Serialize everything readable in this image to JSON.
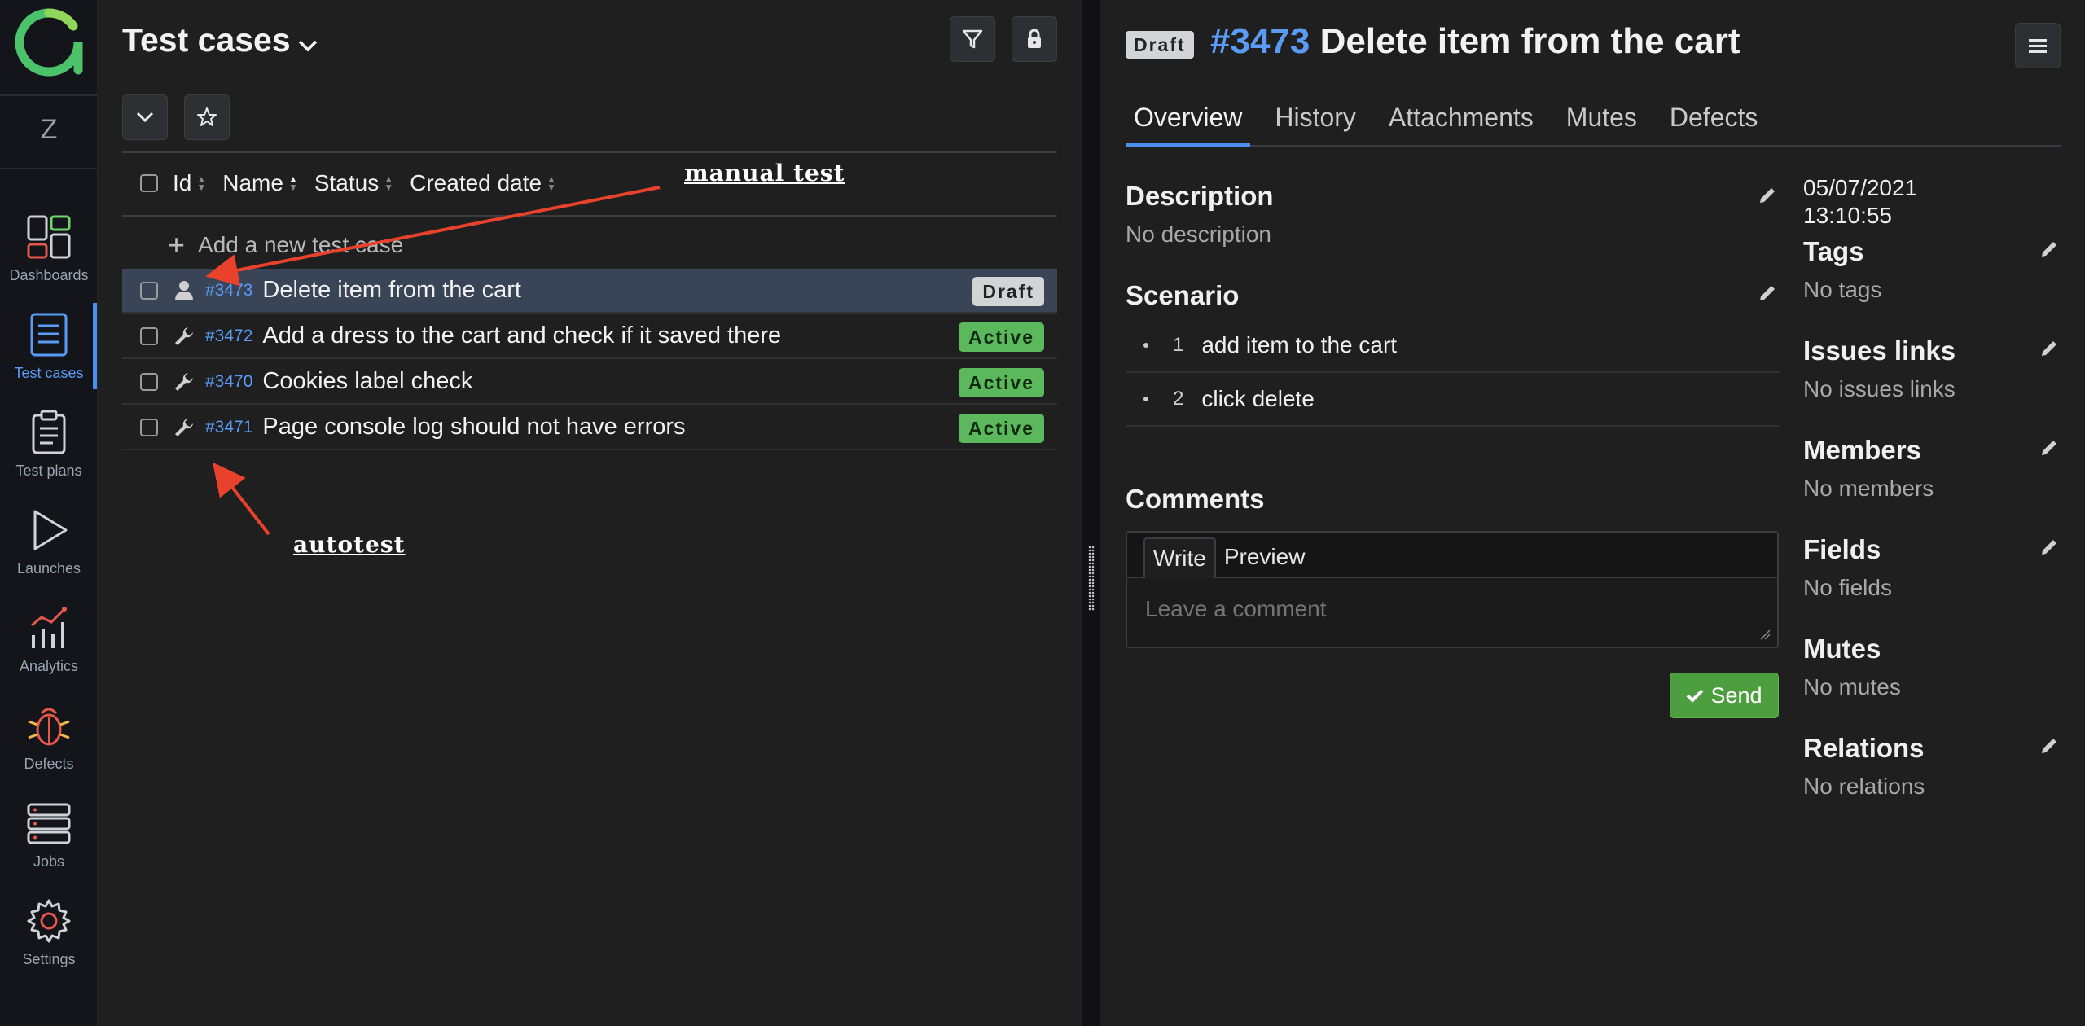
{
  "sidebar": {
    "project_initial": "Z",
    "items": [
      {
        "label": "Dashboards",
        "icon": "dashboards-icon"
      },
      {
        "label": "Test cases",
        "icon": "test-cases-icon",
        "active": true
      },
      {
        "label": "Test plans",
        "icon": "test-plans-icon"
      },
      {
        "label": "Launches",
        "icon": "launches-icon"
      },
      {
        "label": "Analytics",
        "icon": "analytics-icon"
      },
      {
        "label": "Defects",
        "icon": "defects-icon"
      },
      {
        "label": "Jobs",
        "icon": "jobs-icon"
      },
      {
        "label": "Settings",
        "icon": "settings-icon"
      }
    ]
  },
  "list": {
    "title": "Test cases",
    "columns": [
      "Id",
      "Name",
      "Status",
      "Created date"
    ],
    "add_label": "Add a new test case",
    "rows": [
      {
        "id": "#3473",
        "name": "Delete item from the cart",
        "status": "Draft",
        "type": "manual",
        "selected": true
      },
      {
        "id": "#3472",
        "name": "Add a dress to the cart and check if it saved there",
        "status": "Active",
        "type": "automated"
      },
      {
        "id": "#3470",
        "name": "Cookies label check",
        "status": "Active",
        "type": "automated"
      },
      {
        "id": "#3471",
        "name": "Page console log should not have errors",
        "status": "Active",
        "type": "automated"
      }
    ]
  },
  "annotations": {
    "manual": "manual test",
    "auto": "autotest",
    "color": "#e8412c"
  },
  "detail": {
    "status": "Draft",
    "number": "#3473",
    "title": "Delete item from the cart",
    "tabs": [
      "Overview",
      "History",
      "Attachments",
      "Mutes",
      "Defects"
    ],
    "description": {
      "title": "Description",
      "value": "No description"
    },
    "scenario": {
      "title": "Scenario",
      "steps": [
        {
          "n": "1",
          "text": "add item to the cart"
        },
        {
          "n": "2",
          "text": "click delete"
        }
      ]
    },
    "comments": {
      "title": "Comments",
      "write_tab": "Write",
      "preview_tab": "Preview",
      "placeholder": "Leave a comment",
      "send": "Send"
    },
    "created": {
      "date": "05/07/2021",
      "time": "13:10:55"
    },
    "meta": {
      "tags": {
        "title": "Tags",
        "value": "No tags"
      },
      "issues": {
        "title": "Issues links",
        "value": "No issues links"
      },
      "members": {
        "title": "Members",
        "value": "No members"
      },
      "fields": {
        "title": "Fields",
        "value": "No fields"
      },
      "mutes": {
        "title": "Mutes",
        "value": "No mutes"
      },
      "relations": {
        "title": "Relations",
        "value": "No relations"
      }
    }
  },
  "colors": {
    "accent": "#4a8ff0",
    "active_badge": "#5cb85c",
    "draft_badge": "#d2d4d6",
    "send_button": "#4d9e3e",
    "brand": "#4cc36a"
  }
}
